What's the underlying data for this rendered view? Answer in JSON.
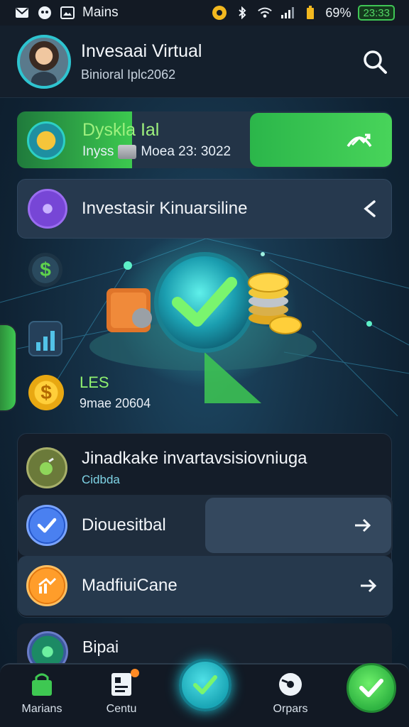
{
  "status_bar": {
    "carrier_label": "Mains",
    "battery_percent": "69%",
    "battery_time": "23:33"
  },
  "header": {
    "title": "Invesaai Virtual",
    "subtitle": "Binioral Iplc2062"
  },
  "card_green": {
    "title": "Dyskla Ial",
    "sub_left": "Inyss",
    "sub_right": "Moea 23: 3022"
  },
  "card_purple": {
    "label": "Investasir Kinuarsiline"
  },
  "stats": {
    "title": "LES",
    "subtitle": "9mae 20604"
  },
  "list": {
    "item1": {
      "title": "Jinadkake invartavsisiovniuga",
      "sub": "Cidbda"
    },
    "item2": {
      "title": "Diouesitbal"
    },
    "item3": {
      "title": "MadfiuiCane"
    },
    "item4": {
      "title": "Bipai"
    }
  },
  "nav": {
    "item1": "Marians",
    "item2": "Centu",
    "item4": "Orpars"
  },
  "colors": {
    "accent_green": "#3cc94f",
    "accent_teal": "#2ec4d0",
    "background": "#12263a"
  }
}
